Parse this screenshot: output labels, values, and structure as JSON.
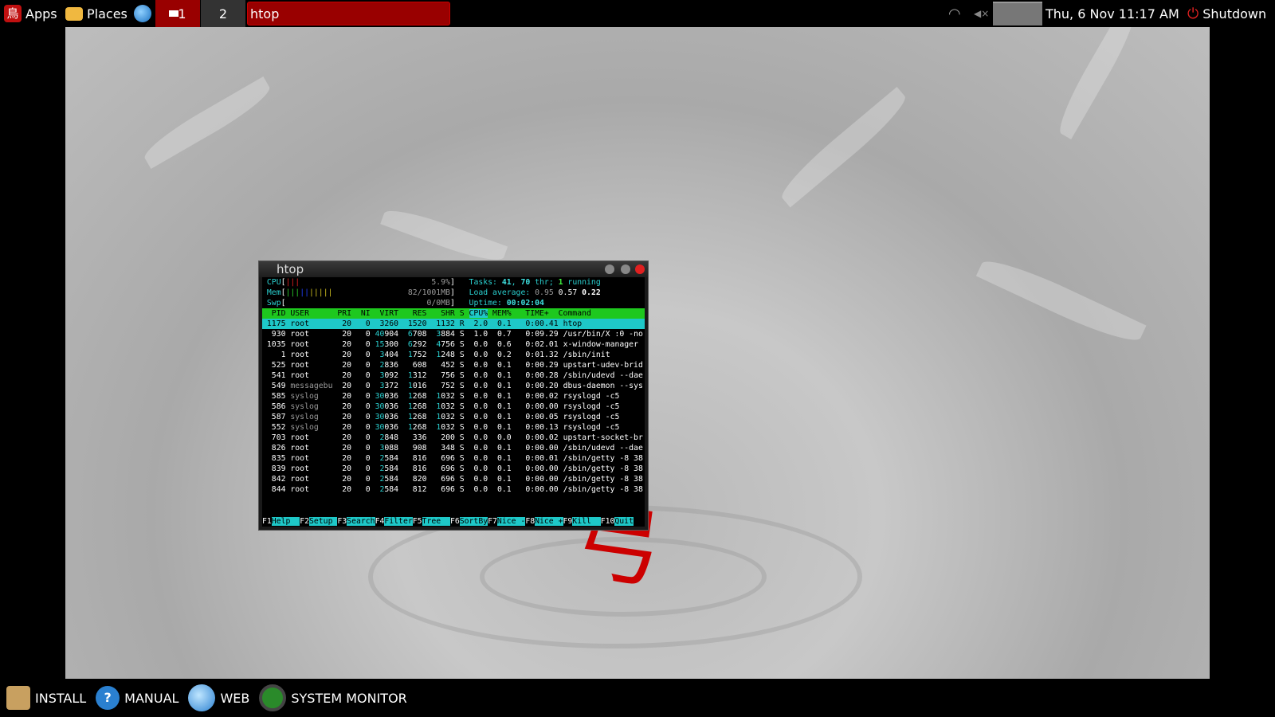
{
  "topbar": {
    "apps": "Apps",
    "places": "Places",
    "workspace1": "1",
    "workspace2": "2",
    "active_window": "htop",
    "clock": "Thu,  6 Nov 11:17 AM",
    "shutdown": "Shutdown"
  },
  "colors": {
    "panel_red": "#990000",
    "accent_cyan": "#1ec8c8",
    "header_green": "#1ec81e"
  },
  "window": {
    "title": "htop"
  },
  "meters": {
    "cpu_label": "CPU",
    "cpu_value": "5.9%",
    "mem_label": "Mem",
    "mem_value": "82/1001MB",
    "swp_label": "Swp",
    "swp_value": "0/0MB",
    "tasks_label": "Tasks: ",
    "tasks": "41",
    "thr_count": "70",
    "thr_label": " thr; ",
    "running": "1",
    "running_label": " running",
    "load_label": "Load average: ",
    "load1": "0.95",
    "load5": "0.57",
    "load15": "0.22",
    "uptime_label": "Uptime: ",
    "uptime": "00:02:04"
  },
  "columns": [
    "PID",
    "USER",
    "PRI",
    "NI",
    "VIRT",
    "RES",
    "SHR",
    "S",
    "CPU%",
    "MEM%",
    "TIME+",
    "Command"
  ],
  "processes": [
    [
      "1175",
      "root",
      "20",
      "0",
      "3260",
      "1520",
      "1132",
      "R",
      "2.0",
      "0.1",
      "0:00.41",
      "htop"
    ],
    [
      "930",
      "root",
      "20",
      "0",
      "40904",
      "6708",
      "3884",
      "S",
      "1.0",
      "0.7",
      "0:09.29",
      "/usr/bin/X :0 -no"
    ],
    [
      "1035",
      "root",
      "20",
      "0",
      "15300",
      "6292",
      "4756",
      "S",
      "0.0",
      "0.6",
      "0:02.01",
      "x-window-manager"
    ],
    [
      "1",
      "root",
      "20",
      "0",
      "3404",
      "1752",
      "1248",
      "S",
      "0.0",
      "0.2",
      "0:01.32",
      "/sbin/init"
    ],
    [
      "525",
      "root",
      "20",
      "0",
      "2836",
      "608",
      "452",
      "S",
      "0.0",
      "0.1",
      "0:00.29",
      "upstart-udev-brid"
    ],
    [
      "541",
      "root",
      "20",
      "0",
      "3092",
      "1312",
      "756",
      "S",
      "0.0",
      "0.1",
      "0:00.28",
      "/sbin/udevd --dae"
    ],
    [
      "549",
      "messagebu",
      "20",
      "0",
      "3372",
      "1016",
      "752",
      "S",
      "0.0",
      "0.1",
      "0:00.20",
      "dbus-daemon --sys"
    ],
    [
      "585",
      "syslog",
      "20",
      "0",
      "30036",
      "1268",
      "1032",
      "S",
      "0.0",
      "0.1",
      "0:00.02",
      "rsyslogd -c5"
    ],
    [
      "586",
      "syslog",
      "20",
      "0",
      "30036",
      "1268",
      "1032",
      "S",
      "0.0",
      "0.1",
      "0:00.00",
      "rsyslogd -c5"
    ],
    [
      "587",
      "syslog",
      "20",
      "0",
      "30036",
      "1268",
      "1032",
      "S",
      "0.0",
      "0.1",
      "0:00.05",
      "rsyslogd -c5"
    ],
    [
      "552",
      "syslog",
      "20",
      "0",
      "30036",
      "1268",
      "1032",
      "S",
      "0.0",
      "0.1",
      "0:00.13",
      "rsyslogd -c5"
    ],
    [
      "703",
      "root",
      "20",
      "0",
      "2848",
      "336",
      "200",
      "S",
      "0.0",
      "0.0",
      "0:00.02",
      "upstart-socket-br"
    ],
    [
      "826",
      "root",
      "20",
      "0",
      "3088",
      "908",
      "348",
      "S",
      "0.0",
      "0.1",
      "0:00.00",
      "/sbin/udevd --dae"
    ],
    [
      "835",
      "root",
      "20",
      "0",
      "2584",
      "816",
      "696",
      "S",
      "0.0",
      "0.1",
      "0:00.01",
      "/sbin/getty -8 38"
    ],
    [
      "839",
      "root",
      "20",
      "0",
      "2584",
      "816",
      "696",
      "S",
      "0.0",
      "0.1",
      "0:00.00",
      "/sbin/getty -8 38"
    ],
    [
      "842",
      "root",
      "20",
      "0",
      "2584",
      "820",
      "696",
      "S",
      "0.0",
      "0.1",
      "0:00.00",
      "/sbin/getty -8 38"
    ],
    [
      "844",
      "root",
      "20",
      "0",
      "2584",
      "812",
      "696",
      "S",
      "0.0",
      "0.1",
      "0:00.00",
      "/sbin/getty -8 38"
    ]
  ],
  "function_keys": [
    [
      "F1",
      "Help  "
    ],
    [
      "F2",
      "Setup "
    ],
    [
      "F3",
      "Search"
    ],
    [
      "F4",
      "Filter"
    ],
    [
      "F5",
      "Tree  "
    ],
    [
      "F6",
      "SortBy"
    ],
    [
      "F7",
      "Nice -"
    ],
    [
      "F8",
      "Nice +"
    ],
    [
      "F9",
      "Kill  "
    ],
    [
      "F10",
      "Quit"
    ]
  ],
  "bottombar": {
    "install": "INSTALL",
    "manual": "MANUAL",
    "web": "WEB",
    "system_monitor": "SYSTEM MONITOR"
  }
}
